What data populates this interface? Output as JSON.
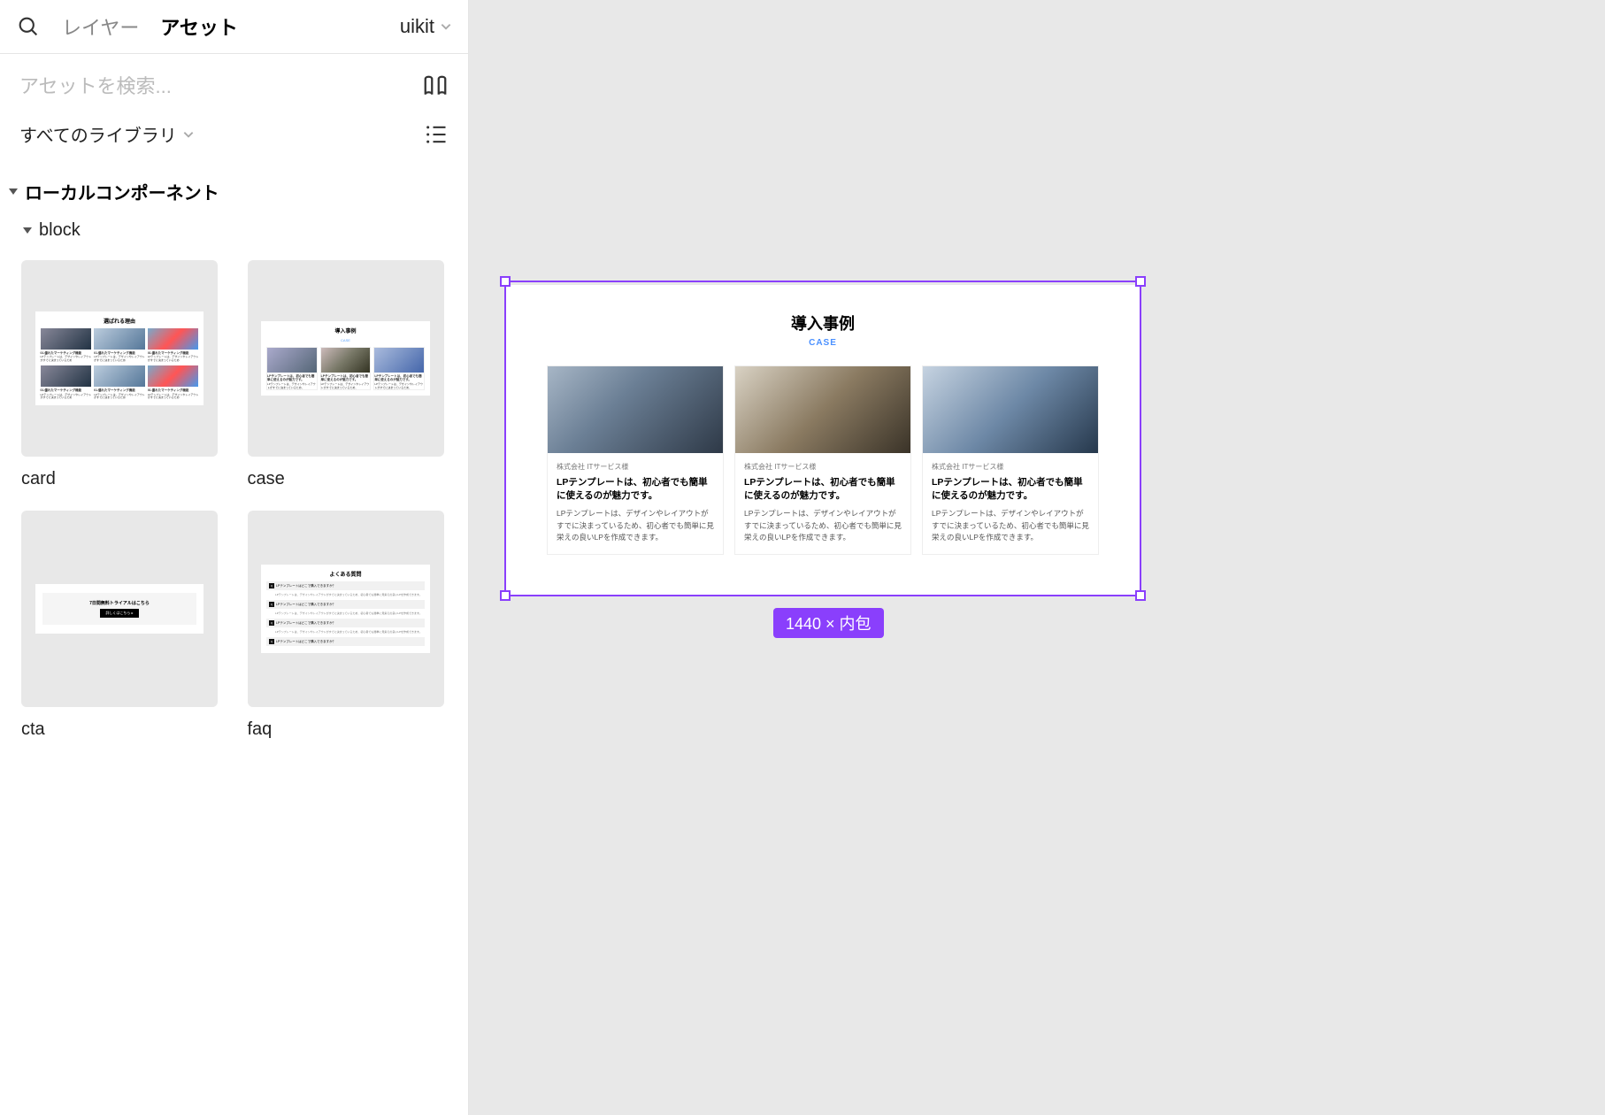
{
  "header": {
    "layers_tab": "レイヤー",
    "assets_tab": "アセット",
    "file_name": "uikit"
  },
  "search": {
    "placeholder": "アセットを検索..."
  },
  "filter": {
    "all_libraries": "すべてのライブラリ"
  },
  "section": {
    "local_components": "ローカルコンポーネント",
    "group_block": "block"
  },
  "assets": [
    {
      "name": "card"
    },
    {
      "name": "case"
    },
    {
      "name": "cta"
    },
    {
      "name": "faq"
    }
  ],
  "thumb": {
    "card_title": "選ばれる理由",
    "card_item_title": "01.優れたマーケティング機能",
    "card_item_body": "LPテンプレートは、デザインやレイアウトがすでに決まっているため",
    "case_title": "導入事例",
    "case_item_title": "LPテンプレートは、初心者でも簡単に使えるのが魅力です。",
    "case_item_body": "LPテンプレートは、デザインやレイアウトがすでに決まっているため、",
    "cta_title": "7日間無料トライアルはこちら",
    "cta_btn": "詳しくはこちら ▸",
    "faq_title": "よくある質問",
    "faq_q": "LPテンプレートはどこで購入できますか？",
    "faq_a": "LPテンプレートは、デザインやレイアウトがすでに決まっているため、初心者でも簡単に見栄えの良いLPを作成できます。"
  },
  "canvas": {
    "size_badge": "1440 × 内包",
    "frame": {
      "title": "導入事例",
      "subtitle": "CASE",
      "cards": [
        {
          "company": "株式会社 ITサービス様",
          "headline": "LPテンプレートは、初心者でも簡単に使えるのが魅力です。",
          "desc": "LPテンプレートは、デザインやレイアウトがすでに決まっているため、初心者でも簡単に見栄えの良いLPを作成できます。"
        },
        {
          "company": "株式会社 ITサービス様",
          "headline": "LPテンプレートは、初心者でも簡単に使えるのが魅力です。",
          "desc": "LPテンプレートは、デザインやレイアウトがすでに決まっているため、初心者でも簡単に見栄えの良いLPを作成できます。"
        },
        {
          "company": "株式会社 ITサービス様",
          "headline": "LPテンプレートは、初心者でも簡単に使えるのが魅力です。",
          "desc": "LPテンプレートは、デザインやレイアウトがすでに決まっているため、初心者でも簡単に見栄えの良いLPを作成できます。"
        }
      ]
    }
  },
  "colors": {
    "selection": "#8a3ffc",
    "accent": "#4a90ff"
  }
}
